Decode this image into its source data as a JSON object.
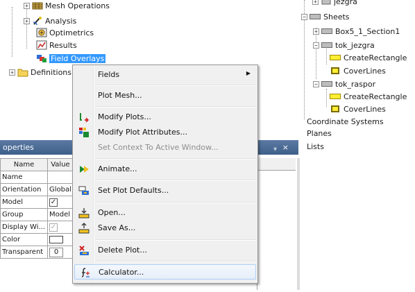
{
  "project_tree": {
    "items": [
      {
        "label": "Mesh Operations"
      },
      {
        "label": "Analysis"
      },
      {
        "label": "Optimetrics"
      },
      {
        "label": "Results"
      },
      {
        "label": "Field Overlays"
      },
      {
        "label": "Definitions"
      }
    ]
  },
  "history_tree": {
    "items": [
      {
        "label": "jezgra"
      },
      {
        "label": "Sheets"
      },
      {
        "label": "Box5_1_Section1"
      },
      {
        "label": "tok_jezgra"
      },
      {
        "label": "CreateRectangle"
      },
      {
        "label": "CoverLines"
      },
      {
        "label": "tok_raspor"
      },
      {
        "label": "CreateRectangle"
      },
      {
        "label": "CoverLines"
      },
      {
        "label": "Coordinate Systems"
      },
      {
        "label": "Planes"
      },
      {
        "label": "Lists"
      }
    ]
  },
  "properties": {
    "title": "operties",
    "pin_button": "ᵩ",
    "close_button": "×",
    "columns": [
      "Name",
      "Value"
    ],
    "rows": [
      {
        "name": "Name",
        "value": ""
      },
      {
        "name": "Orientation",
        "value": "Global"
      },
      {
        "name": "Model",
        "value": "✓"
      },
      {
        "name": "Group",
        "value": "Model"
      },
      {
        "name": "Display Wi...",
        "value": "✓"
      },
      {
        "name": "Color",
        "value": ""
      },
      {
        "name": "Transparent",
        "value": "0"
      }
    ]
  },
  "context_menu": {
    "items": [
      {
        "label": "Fields",
        "submenu_arrow": "▶",
        "icon": "none"
      },
      {
        "label": "Plot Mesh...",
        "icon": "none"
      },
      {
        "label": "Modify Plots...",
        "icon": "modify-plots-icon"
      },
      {
        "label": "Modify Plot Attributes...",
        "icon": "plot-attributes-icon"
      },
      {
        "label": "Set Context To Active Window...",
        "icon": "none",
        "disabled": true
      },
      {
        "label": "Animate...",
        "icon": "animate-icon"
      },
      {
        "label": "Set Plot Defaults...",
        "icon": "plot-defaults-icon"
      },
      {
        "label": "Open...",
        "icon": "open-icon"
      },
      {
        "label": "Save As...",
        "icon": "save-as-icon"
      },
      {
        "label": "Delete Plot...",
        "icon": "delete-plot-icon"
      },
      {
        "label": "Calculator...",
        "icon": "calculator-icon"
      }
    ]
  },
  "colors": {
    "selection": "#3399ff",
    "menu_bg": "#f0f0f0",
    "panel_title": "#4a6a95",
    "hover_border": "#aecff7"
  }
}
